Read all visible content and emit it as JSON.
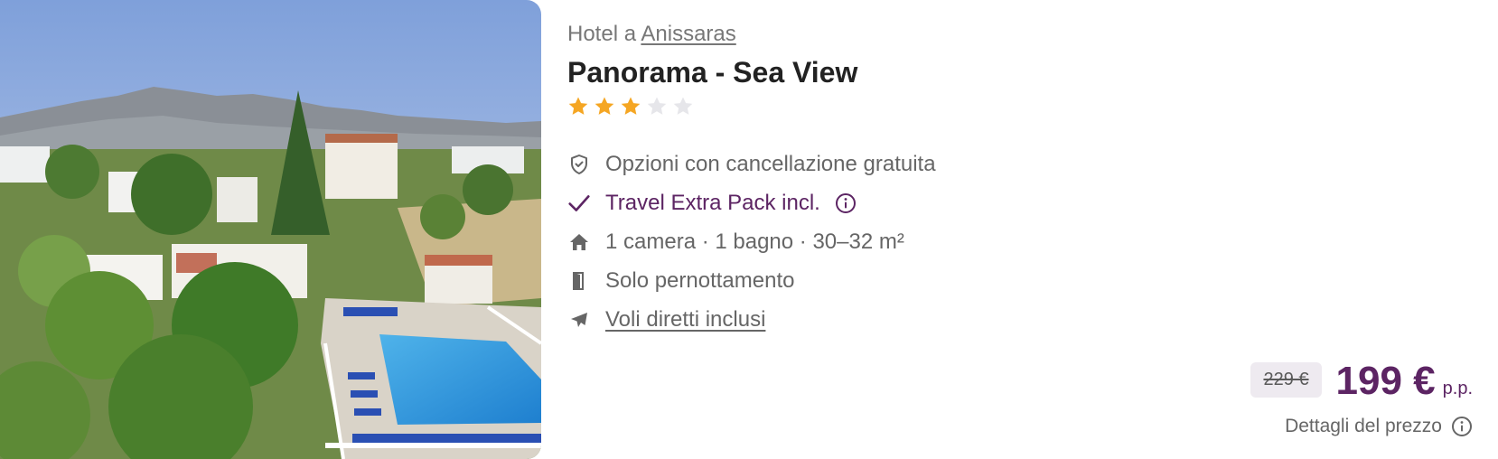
{
  "hotel": {
    "location_prefix": "Hotel a",
    "location_place": "Anissaras",
    "name": "Panorama - Sea View",
    "rating": {
      "value": 3,
      "max": 5,
      "filled_color": "#f5a623",
      "empty_color": "#e6e6ea"
    }
  },
  "features": [
    {
      "icon": "shield-check-icon",
      "label": "Opzioni con cancellazione gratuita"
    },
    {
      "icon": "check-icon",
      "label": "Travel Extra Pack incl.",
      "info_icon": "info-icon"
    },
    {
      "icon": "house-icon",
      "label": "1 camera · 1 bagno · 30–32 m²"
    },
    {
      "icon": "door-icon",
      "label": "Solo pernottamento"
    },
    {
      "icon": "plane-icon",
      "label": "Voli diretti inclusi"
    }
  ],
  "price": {
    "old": "229 €",
    "current": "199 €",
    "unit": "p.p.",
    "details_label": "Dettagli del prezzo"
  },
  "colors": {
    "accent": "#5c2463",
    "muted_text": "#666666",
    "star": "#f5a623"
  }
}
